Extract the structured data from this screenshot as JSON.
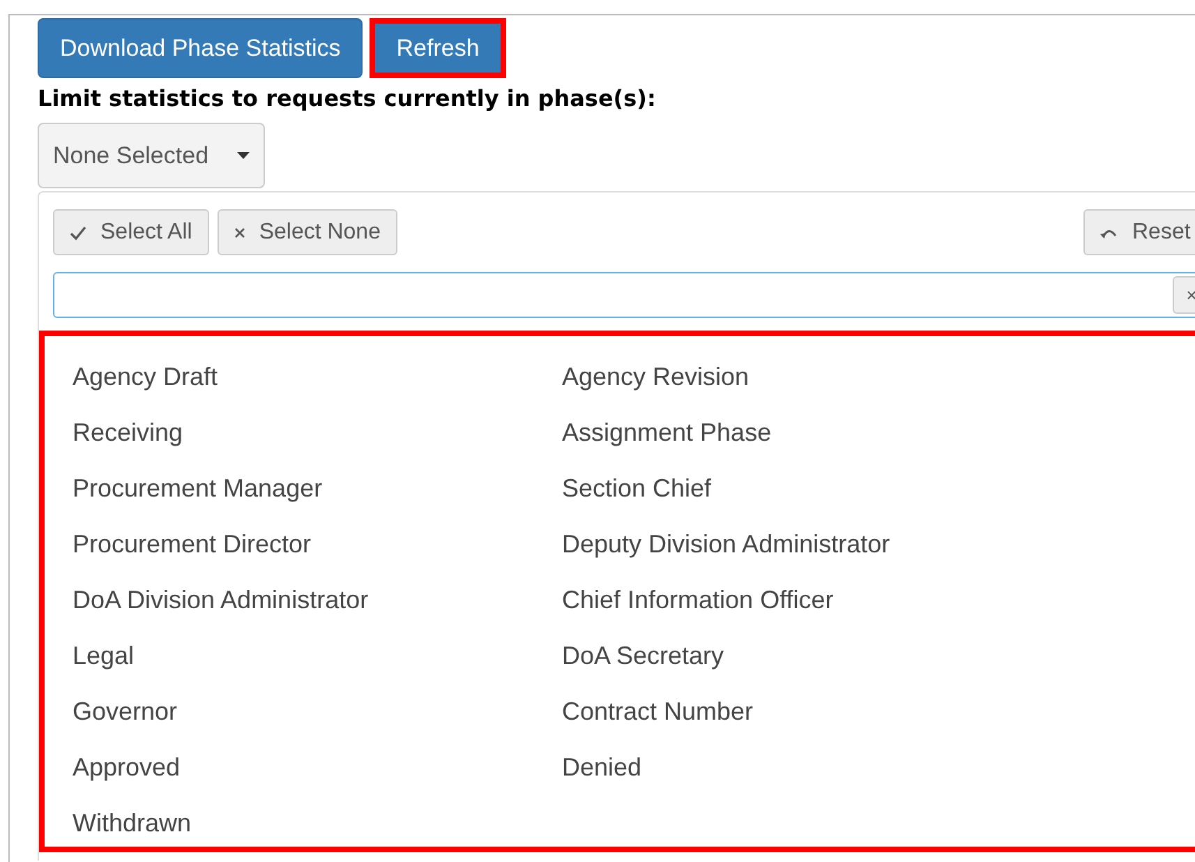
{
  "buttons": [
    {
      "label": "Download Phase Statistics",
      "highlighted": false
    },
    {
      "label": "Refresh",
      "highlighted": true
    }
  ],
  "filter_label": "Limit statistics to requests currently in phase(s):",
  "dropdown": {
    "value": "None Selected",
    "expanded": true
  },
  "toolbar": [
    {
      "kind": "select_all",
      "label": "Select All"
    },
    {
      "kind": "select_none",
      "label": "Select None"
    },
    {
      "kind": "reset",
      "label": "Reset"
    }
  ],
  "search": {
    "clear": "×"
  },
  "options_highlighted": true,
  "options": [
    {
      "label": "Agency Draft"
    },
    {
      "label": "Agency Revision"
    },
    {
      "label": "Receiving"
    },
    {
      "label": "Assignment Phase"
    },
    {
      "label": "Procurement Manager"
    },
    {
      "label": "Section Chief"
    },
    {
      "label": "Procurement Director"
    },
    {
      "label": "Deputy Division Administrator"
    },
    {
      "label": "DoA Division Administrator"
    },
    {
      "label": "Chief Information Officer"
    },
    {
      "label": "Legal"
    },
    {
      "label": "DoA Secretary"
    },
    {
      "label": "Governor"
    },
    {
      "label": "Contract Number"
    },
    {
      "label": "Approved"
    },
    {
      "label": "Denied"
    },
    {
      "label": "Withdrawn"
    }
  ]
}
